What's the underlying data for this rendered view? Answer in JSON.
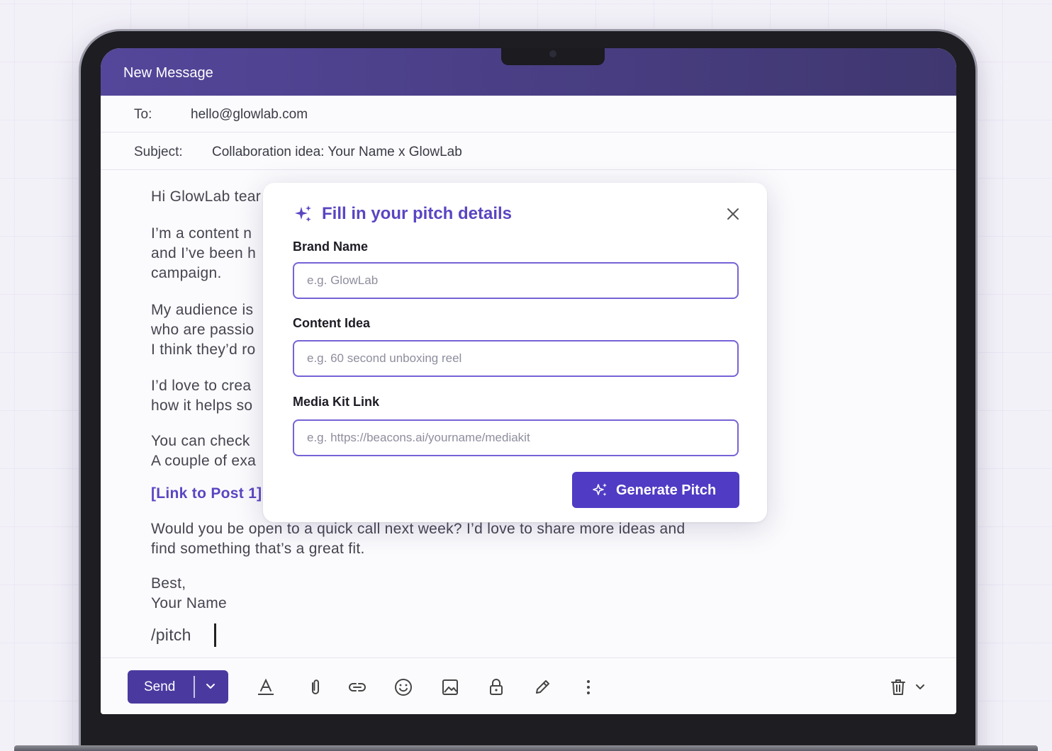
{
  "window": {
    "title": "New Message"
  },
  "email": {
    "to_label": "To:",
    "to_value": "hello@glowlab.com",
    "subject_label": "Subject:",
    "subject_value": "Collaboration idea: Your Name x GlowLab",
    "body": {
      "greeting": "Hi GlowLab tear",
      "p1_line1": "I’m a content n",
      "p1_line2": "and I’ve been h",
      "p1_line3": "campaign.",
      "p2_line1": "My audience is",
      "p2_line2": "who are passio",
      "p2_line3": "I think they’d ro",
      "p3_line1": "I’d love to crea",
      "p3_line2": "how it helps so",
      "p4_line1": "You can check",
      "p4_line2": "A couple of exa",
      "link1": "[Link to Post 1]",
      "p5_line1": "Would you be open to a quick call next week? I’d love to share more ideas and",
      "p5_line2": "find something that’s a great fit.",
      "signoff": "Best,",
      "signature": "Your Name",
      "command": "/pitch"
    }
  },
  "toolbar": {
    "send_label": "Send",
    "icons": [
      "text-format-icon",
      "attachment-icon",
      "link-icon",
      "emoji-icon",
      "image-icon",
      "lock-icon",
      "signature-pen-icon",
      "more-vertical-icon",
      "trash-icon",
      "chevron-down-icon"
    ]
  },
  "modal": {
    "title": "Fill in your pitch details",
    "fields": {
      "brand_label": "Brand Name",
      "brand_placeholder": "e.g. GlowLab",
      "content_label": "Content Idea",
      "content_placeholder": "e.g. 60 second unboxing reel",
      "media_label": "Media Kit Link",
      "media_placeholder": "e.g. https://beacons.ai/yourname/mediakit"
    },
    "generate_label": "Generate Pitch"
  },
  "colors": {
    "accent": "#4f3bc4",
    "titlebar": "#4a3f85",
    "link": "#5a45c2"
  }
}
